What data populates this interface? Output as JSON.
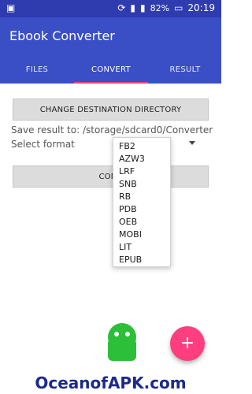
{
  "status_bar": {
    "battery_percent": "82%",
    "time": "20:19",
    "icons": [
      "image-icon",
      "sync-icon",
      "signal-icon",
      "battery-icon"
    ]
  },
  "app": {
    "title": "Ebook Converter"
  },
  "tabs": [
    {
      "label": "FILES",
      "active": false
    },
    {
      "label": "CONVERT",
      "active": true
    },
    {
      "label": "RESULT",
      "active": false
    }
  ],
  "content": {
    "change_dir_button": "CHANGE DESTINATION DIRECTORY",
    "save_result_label": "Save result to: /storage/sdcard0/Converter",
    "select_format_label": "Select format",
    "convert_button_partial": "CONV"
  },
  "dropdown": {
    "options": [
      "FB2",
      "AZW3",
      "LRF",
      "SNB",
      "RB",
      "PDB",
      "OEB",
      "MOBI",
      "LIT",
      "EPUB"
    ]
  },
  "fab": {
    "icon": "plus-icon"
  },
  "watermark": {
    "text": "OceanofAPK.com"
  },
  "colors": {
    "statusbar": "#2f3cb0",
    "appbar": "#3a4fc6",
    "accent": "#ff4081",
    "button": "#dcdcdc"
  }
}
